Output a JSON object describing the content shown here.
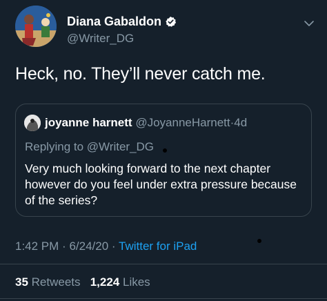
{
  "author": {
    "display_name": "Diana Gabaldon",
    "handle": "@Writer_DG",
    "avatar_icon": "profile-avatar",
    "verified_icon": "verified-badge-icon"
  },
  "tweet": {
    "text": "Heck, no.  They’ll never catch me."
  },
  "quoted_tweet": {
    "display_name": "joyanne harnett",
    "handle": "@JoyanneHarnett",
    "separator": "·",
    "time": "4d",
    "replying_prefix": "Replying to",
    "replying_to": "@Writer_DG",
    "text": "Very much looking forward to the next chapter however do you feel under extra pressure because of the series?"
  },
  "meta": {
    "time": "1:42 PM",
    "sep1": "·",
    "date": "6/24/20",
    "sep2": "·",
    "source": "Twitter for iPad"
  },
  "stats": {
    "retweets_count": "35",
    "retweets_label": "Retweets",
    "likes_count": "1,224",
    "likes_label": "Likes"
  },
  "colors": {
    "background": "#15202b",
    "secondary_text": "#8899a6",
    "link": "#1da1f2",
    "border": "#38444d"
  }
}
